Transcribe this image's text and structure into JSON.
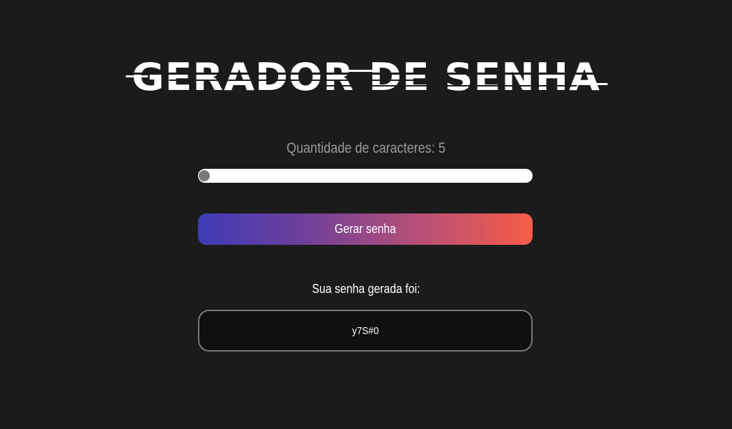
{
  "header": {
    "title": "GERADOR DE SENHA"
  },
  "length_control": {
    "label": "Quantidade de caracteres: 5",
    "value": 5,
    "fill_fraction": 0.0
  },
  "actions": {
    "generate_label": "Gerar senha"
  },
  "result": {
    "label": "Sua senha gerada foi:",
    "password": "y7S#0"
  },
  "colors": {
    "background": "#1b1b1b",
    "gradient_start": "#3f3bb7",
    "gradient_end": "#f75c48",
    "label_gray": "#9a9a9a",
    "result_box_bg": "#101010"
  }
}
